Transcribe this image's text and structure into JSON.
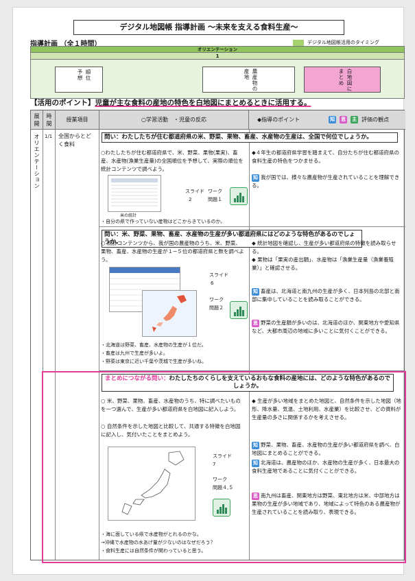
{
  "header": {
    "title": "デジタル地図帳 指導計画 〜未来を支える食料生産〜",
    "subtitle": "指導計画 （全１時間）",
    "legend_label": "デジタル地図帳活用のタイミング",
    "legend_color": "#a6d26e"
  },
  "orientation": {
    "bar_label": "オリエンテーション",
    "number": "1",
    "box1": [
      "予想",
      "順位"
    ],
    "box2": [
      "農産物の",
      "産地"
    ],
    "box3": [
      "白地図に",
      "まとめ"
    ]
  },
  "point": {
    "label": "【活用のポイント】",
    "text": "児童が主な食料の産地の特色を白地図にまとめるときに活用する。"
  },
  "table_header": {
    "col1": [
      "展",
      "開"
    ],
    "col2": [
      "時",
      "間"
    ],
    "col3": "授業項目",
    "col4": "○学習活動　・児童の反応",
    "col5": "◆指導のポイント",
    "col5_suffix": "評価の観点",
    "badge_chi": "知",
    "badge_shi": "思",
    "badge_shu": "主"
  },
  "row": {
    "stage": "オリエンテーション",
    "time": "1/1",
    "item": "全国からとどく食料"
  },
  "section1": {
    "question": "問い：わたしたちが住む都道府県の米、野菜、果物、畜産、水産物の生産は、全国で何位でしょうか。",
    "activity": "○わたしたちが住む都道府県で、米、野菜、果物(果実)、畜産、水産物(漁業生産量)の全国順位を予想して、実際の順位を統計コンテンツで調べよう。",
    "thumb_caption": "米の統計",
    "slide_label": "スライド",
    "slide_num": "2",
    "work_label": "ワーク",
    "work_num": "問題１",
    "reaction": "・自分の県で作っていない産物はどこからきているのか。",
    "points": [
      "◆４年生の都道府県学習を踏まえて、自分たちが住む都道府県の食料生産の特色をつかませる。"
    ],
    "eval_chi": "我が国では、様々な農産物が生産されていることを理解できる。"
  },
  "section2": {
    "question": "問い：米、野菜、果物、畜産、水産物の生産が多い都道府県にはどのような特色があるのでしょうか。",
    "activity": "○ 統計コンテンツから、我が国の農産物のうち、米、野菜、果物、畜産、水産物の生産が１−５位の都道府県と数を調べよう。",
    "slide_label": "スライド",
    "slide_num": "6",
    "work_label": "ワーク",
    "work_num": "問題２",
    "reactions": [
      "・北海道は野菜、畜産、水産物の生産が１位だ。",
      "・畜産は九州で生産が多いよ。",
      "・野菜は東京に近い千葉や茨城で生産が多いね。"
    ],
    "points": [
      "◆ 統計地図を確認し、生産が多い都道府県の特徴を読み取らせる。",
      "◆ 果物は「果実の産出額」、水産物は「漁業生産量（漁業養殖業）」と確認させる。"
    ],
    "eval_chi": "畜産は、北海道と南九州の生産が多く、日本列島の北部と南部に集中していることを読み取ることができる。",
    "eval_shi": "野菜の生産額が多いのは、北海道のほか、関東地方や愛知県など、大都市周辺の地域に多いことに気付くことができる。"
  },
  "section3": {
    "question_label": "まとめにつながる問い：",
    "question": "わたしたちのくらしを支えているおもな食料の産地には、どのような特色があるのでしょうか。",
    "activities": [
      "○ 米、野菜、果物、畜産、水産物のうち、特に調べたいものを一つ選んで、生産が多い都道府県を白地図に記入しよう。",
      "○ 自然条件を示した地図と比較して、共通する特徴を白地図に記入し、気付いたことをまとめよう。"
    ],
    "slide_label": "スライド",
    "slide_num": "7",
    "work_label": "ワーク",
    "work_num": "問題４,５",
    "reactions": [
      "・海に面している県で水産物がとれるのかな。",
      "→沖縄で水産物の水あげ量が少ないのはなぜだろう？",
      "・食料生産には自然条件が関わっていると思う。"
    ],
    "points": [
      "◆ 生産が多い地域をまとめた地図と、自然条件を示した地図（地形、降水量、気温、土地利用、水産業）を比較させ、どの資料が生産量の多さに関係するかを考えさせる。"
    ],
    "eval_chi1": "野菜、果物、畜産、水産物の生産が多い都道府県を調べ、白地図にまとめることができる。",
    "eval_chi2": "北海道は、農産物のほか、水産物の生産が多く、日本最大の食料生産地であることに気付くことができる。",
    "eval_shi": "南九州は畜産、関東地方は野菜、東北地方は米、中部地方は果物の生産が多い地域であり、地域によって特色のある農産物が生産されていることを読み取り、表現できる。"
  },
  "thumb_table": {
    "rows": [
      "北海道",
      "新潟県",
      "秋田県",
      "山形県",
      "宮城県",
      "福島県",
      "茨城県",
      "栃木県",
      "千葉県"
    ]
  },
  "map_rank": {
    "rows": [
      "1 北海道",
      "2 鹿児島",
      "3 宮崎",
      "4 岩手",
      "5 群馬"
    ]
  }
}
